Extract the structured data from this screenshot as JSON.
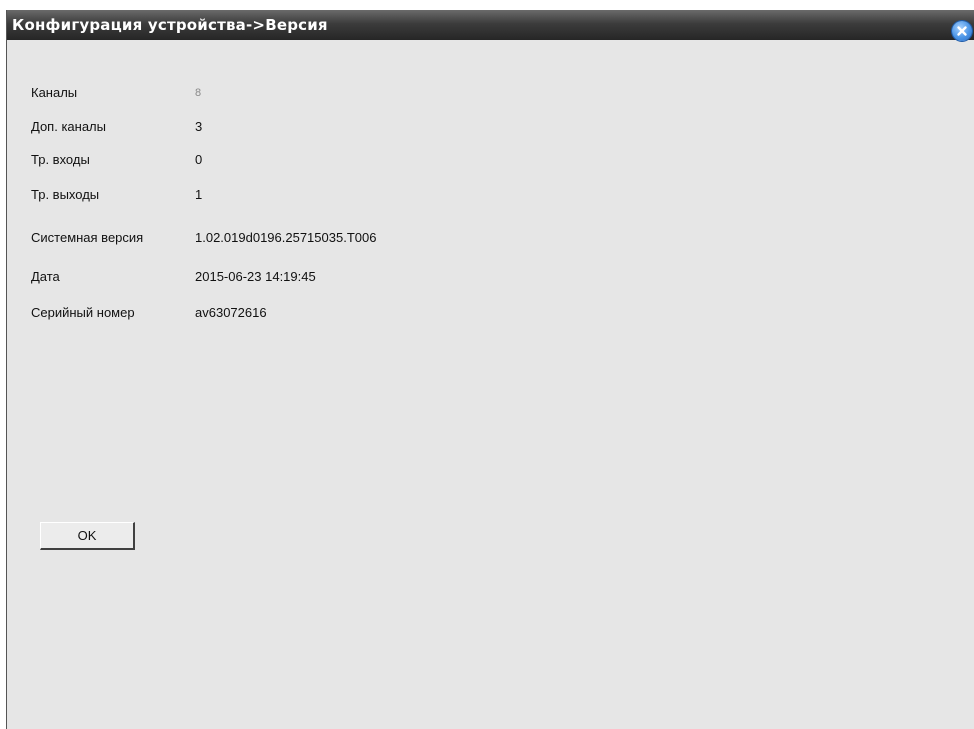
{
  "window": {
    "title": "Конфигурация устройства->Версия"
  },
  "info": {
    "rows": [
      {
        "label": "Каналы",
        "value": "8"
      },
      {
        "label": "Доп. каналы",
        "value": "3"
      },
      {
        "label": "Тр. входы",
        "value": "0"
      },
      {
        "label": "Тр. выходы",
        "value": "1"
      },
      {
        "label": "Системная версия",
        "value": "1.02.019d0196.25715035.T006"
      },
      {
        "label": "Дата",
        "value": "2015-06-23 14:19:45"
      },
      {
        "label": "Серийный номер",
        "value": "av63072616"
      }
    ]
  },
  "buttons": {
    "ok_label": "OK"
  },
  "icons": {
    "close": "close-icon"
  },
  "colors": {
    "titlebar": "#262626",
    "body": "#e6e6e6",
    "close_accent": "#4a94e6"
  }
}
